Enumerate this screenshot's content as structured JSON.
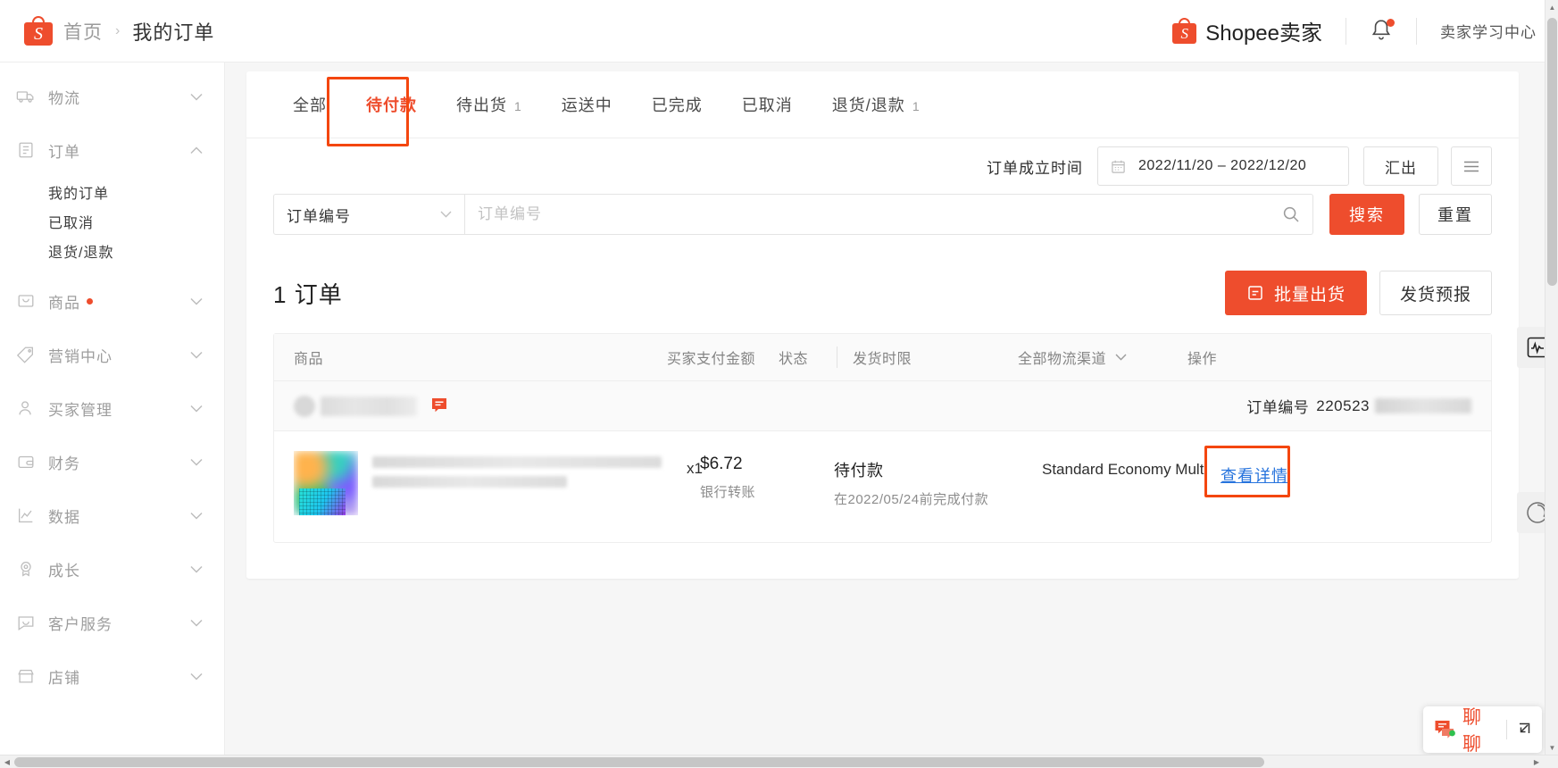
{
  "header": {
    "breadcrumb_home": "首页",
    "breadcrumb_sep": "›",
    "breadcrumb_current": "我的订单",
    "brand_name": "Shopee卖家",
    "brand_mark": "S",
    "learning_center": "卖家学习中心",
    "notification_icon": "bell-icon",
    "notification_has_unread": true
  },
  "sidebar": {
    "groups": [
      {
        "label": "物流",
        "icon": "truck-icon",
        "expanded": false,
        "badge": false
      },
      {
        "label": "订单",
        "icon": "clipboard-icon",
        "expanded": true,
        "badge": false,
        "children": [
          {
            "label": "我的订单",
            "active": true
          },
          {
            "label": "已取消",
            "active": false
          },
          {
            "label": "退货/退款",
            "active": false
          }
        ]
      },
      {
        "label": "商品",
        "icon": "box-icon",
        "expanded": false,
        "badge": true
      },
      {
        "label": "营销中心",
        "icon": "tag-icon",
        "expanded": false,
        "badge": false
      },
      {
        "label": "买家管理",
        "icon": "user-icon",
        "expanded": false,
        "badge": false
      },
      {
        "label": "财务",
        "icon": "wallet-icon",
        "expanded": false,
        "badge": false
      },
      {
        "label": "数据",
        "icon": "chart-line-icon",
        "expanded": false,
        "badge": false
      },
      {
        "label": "成长",
        "icon": "medal-icon",
        "expanded": false,
        "badge": false
      },
      {
        "label": "客户服务",
        "icon": "chat-bubble-icon",
        "expanded": false,
        "badge": false
      },
      {
        "label": "店铺",
        "icon": "storefront-icon",
        "expanded": false,
        "badge": false
      }
    ]
  },
  "tabs": [
    {
      "label": "全部",
      "count": "",
      "selected": false
    },
    {
      "label": "待付款",
      "count": "",
      "selected": true,
      "highlighted": true
    },
    {
      "label": "待出货",
      "count": "1",
      "selected": false
    },
    {
      "label": "运送中",
      "count": "",
      "selected": false
    },
    {
      "label": "已完成",
      "count": "",
      "selected": false
    },
    {
      "label": "已取消",
      "count": "",
      "selected": false
    },
    {
      "label": "退货/退款",
      "count": "1",
      "selected": false
    }
  ],
  "filter": {
    "date_label": "订单成立时间",
    "date_value": "2022/11/20 – 2022/12/20",
    "calendar_icon": "calendar-icon",
    "export_label": "汇出",
    "menu_icon": "hamburger-icon"
  },
  "search": {
    "field_selector_value": "订单编号",
    "field_selector_icon": "chevron-down-icon",
    "placeholder": "订单编号",
    "value": "",
    "search_icon": "magnifier-icon",
    "search_label": "搜索",
    "reset_label": "重置"
  },
  "orders_summary": {
    "count": "1",
    "count_label": "订单",
    "bulk_ship_label": "批量出货",
    "bulk_ship_icon": "package-icon",
    "forecast_label": "发货预报"
  },
  "table": {
    "columns": {
      "product": "商品",
      "paid_amount": "买家支付金额",
      "status": "状态",
      "ship_deadline": "发货时限",
      "logistics_channel": "全部物流渠道",
      "logistics_chevron_icon": "chevron-down-icon",
      "action": "操作"
    },
    "rows": [
      {
        "shop_name_redacted": true,
        "chat_icon": "chat-icon",
        "order_no_label": "订单编号",
        "order_no_value": "220523",
        "order_no_redacted": true,
        "product_name_redacted": true,
        "quantity": "x1",
        "paid_amount": "$6.72",
        "payment_method": "银行转账",
        "status": "待付款",
        "status_note": "在2022/05/24前完成付款",
        "logistics_channel": "Standard Economy Multi",
        "action_label": "查看详情",
        "action_highlighted": true
      }
    ]
  },
  "floating": {
    "chart_widget_icon": "activity-chart-icon",
    "circle_widget_icon": "spinner-circle-icon",
    "chat_label": "聊聊",
    "chat_icon": "chat-icon",
    "chat_expand_icon": "expand-arrow-icon"
  },
  "colors": {
    "brand_orange": "#ee4d2d",
    "highlight_red": "#f4460f",
    "link_blue": "#2673dd",
    "text_dark": "#222222",
    "text_muted": "#9b9b9b",
    "page_bg": "#f6f6f6"
  }
}
